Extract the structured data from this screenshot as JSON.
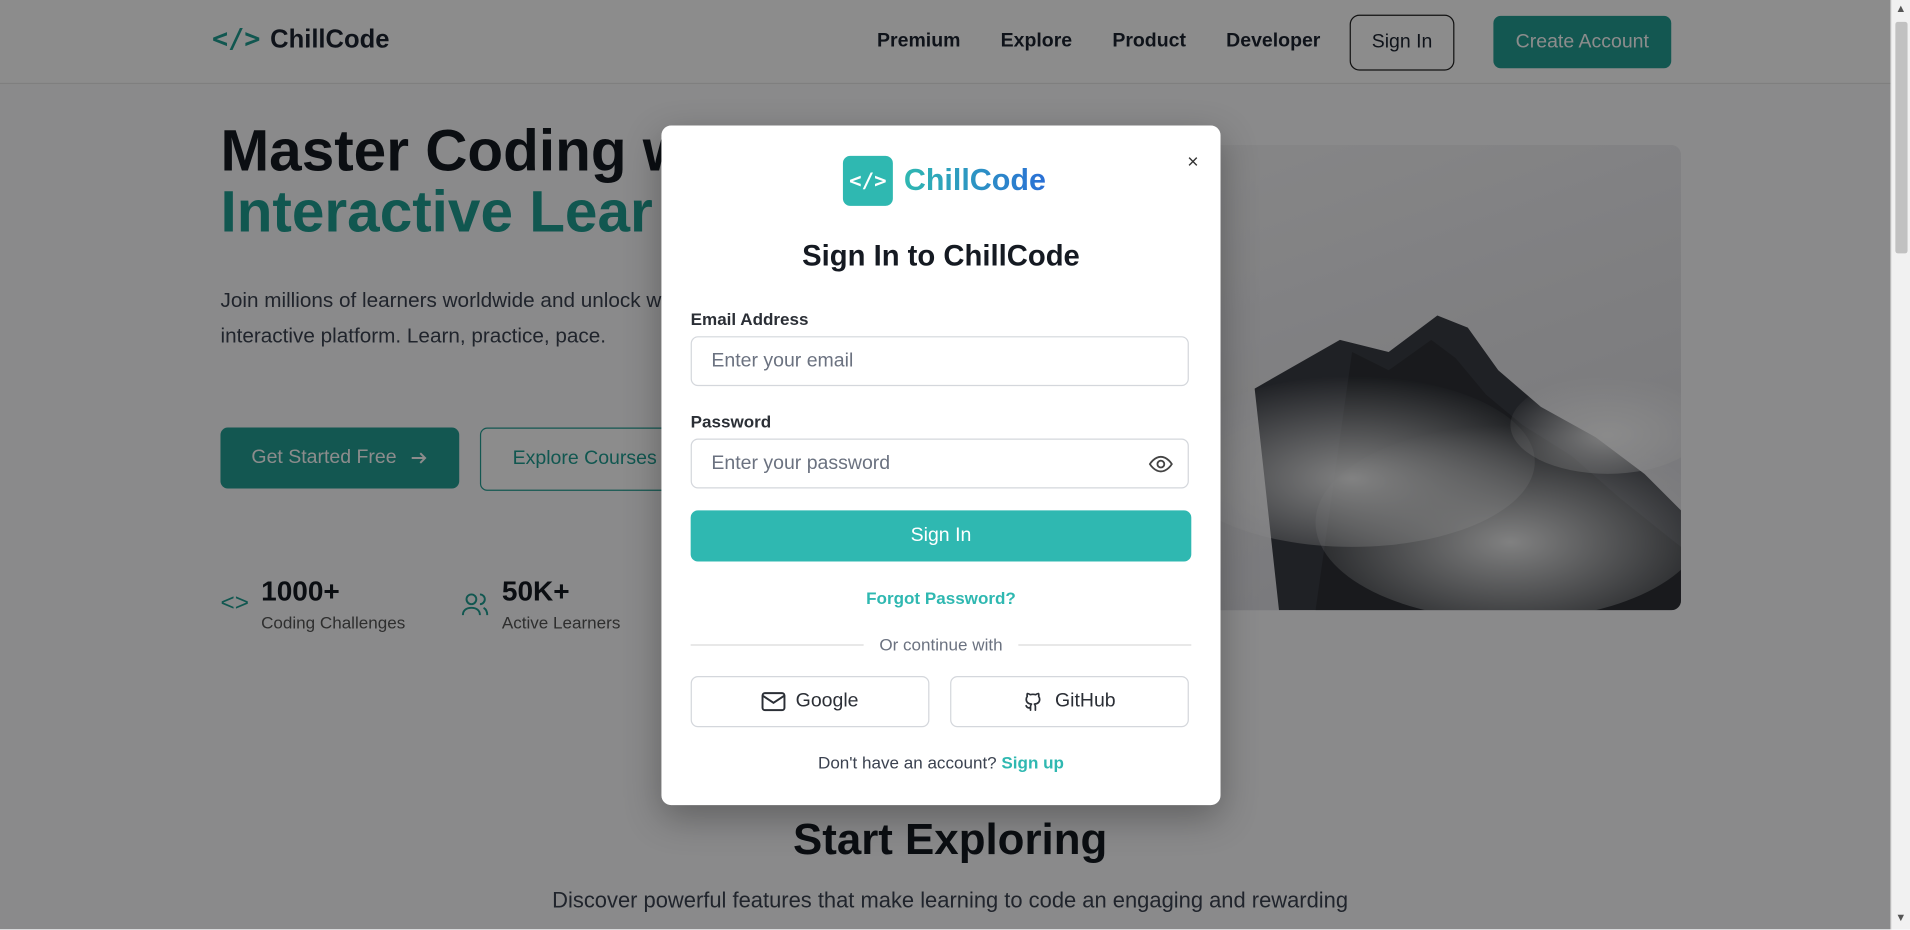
{
  "nav": {
    "brand": "ChillCode",
    "links": [
      "Premium",
      "Explore",
      "Product",
      "Developer"
    ],
    "signin": "Sign In",
    "create": "Create Account"
  },
  "hero": {
    "title_line1": "Master Coding w",
    "title_line2": "Interactive Lear",
    "description": "Join millions of learners worldwide and unlock with our interactive platform. Learn, practice, pace.",
    "cta_primary": "Get Started Free",
    "cta_secondary": "Explore Courses",
    "stats": [
      {
        "value": "1000+",
        "label": "Coding Challenges"
      },
      {
        "value": "50K+",
        "label": "Active Learners"
      }
    ]
  },
  "section": {
    "title": "Start Exploring",
    "subtitle": "Discover powerful features that make learning to code an engaging and rewarding"
  },
  "modal": {
    "brand": "ChillCode",
    "logo_glyph": "</>",
    "title": "Sign In to ChillCode",
    "email_label": "Email Address",
    "email_placeholder": "Enter your email",
    "password_label": "Password",
    "password_placeholder": "Enter your password",
    "submit": "Sign In",
    "forgot": "Forgot Password?",
    "divider": "Or continue with",
    "google": "Google",
    "github": "GitHub",
    "signup_prompt": "Don't have an account?",
    "signup_link": "Sign up",
    "close": "×"
  },
  "colors": {
    "accent": "#2fb8b1",
    "accent_dark": "#249e94",
    "gradient_end": "#2a6fd6"
  }
}
